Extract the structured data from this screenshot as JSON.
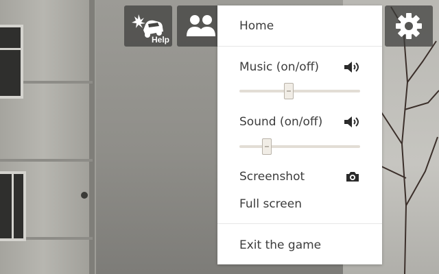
{
  "toolbar": {
    "help_label": "Help",
    "players_count": "2"
  },
  "menu": {
    "home": "Home",
    "music_label": "Music (on/off)",
    "music_level": 0.41,
    "sound_label": "Sound (on/off)",
    "sound_level": 0.23,
    "screenshot_label": "Screenshot",
    "fullscreen_label": "Full screen",
    "exit_label": "Exit the game"
  },
  "icons": {
    "help": "crashed-car-icon",
    "players": "two-people-icon",
    "settings": "gear-icon",
    "music": "speaker-icon",
    "sound": "speaker-icon",
    "screenshot": "camera-icon"
  },
  "colors": {
    "menu_background": "#ffffff",
    "menu_text": "#3c3c3c",
    "hud_button": "#3c3c3a"
  }
}
